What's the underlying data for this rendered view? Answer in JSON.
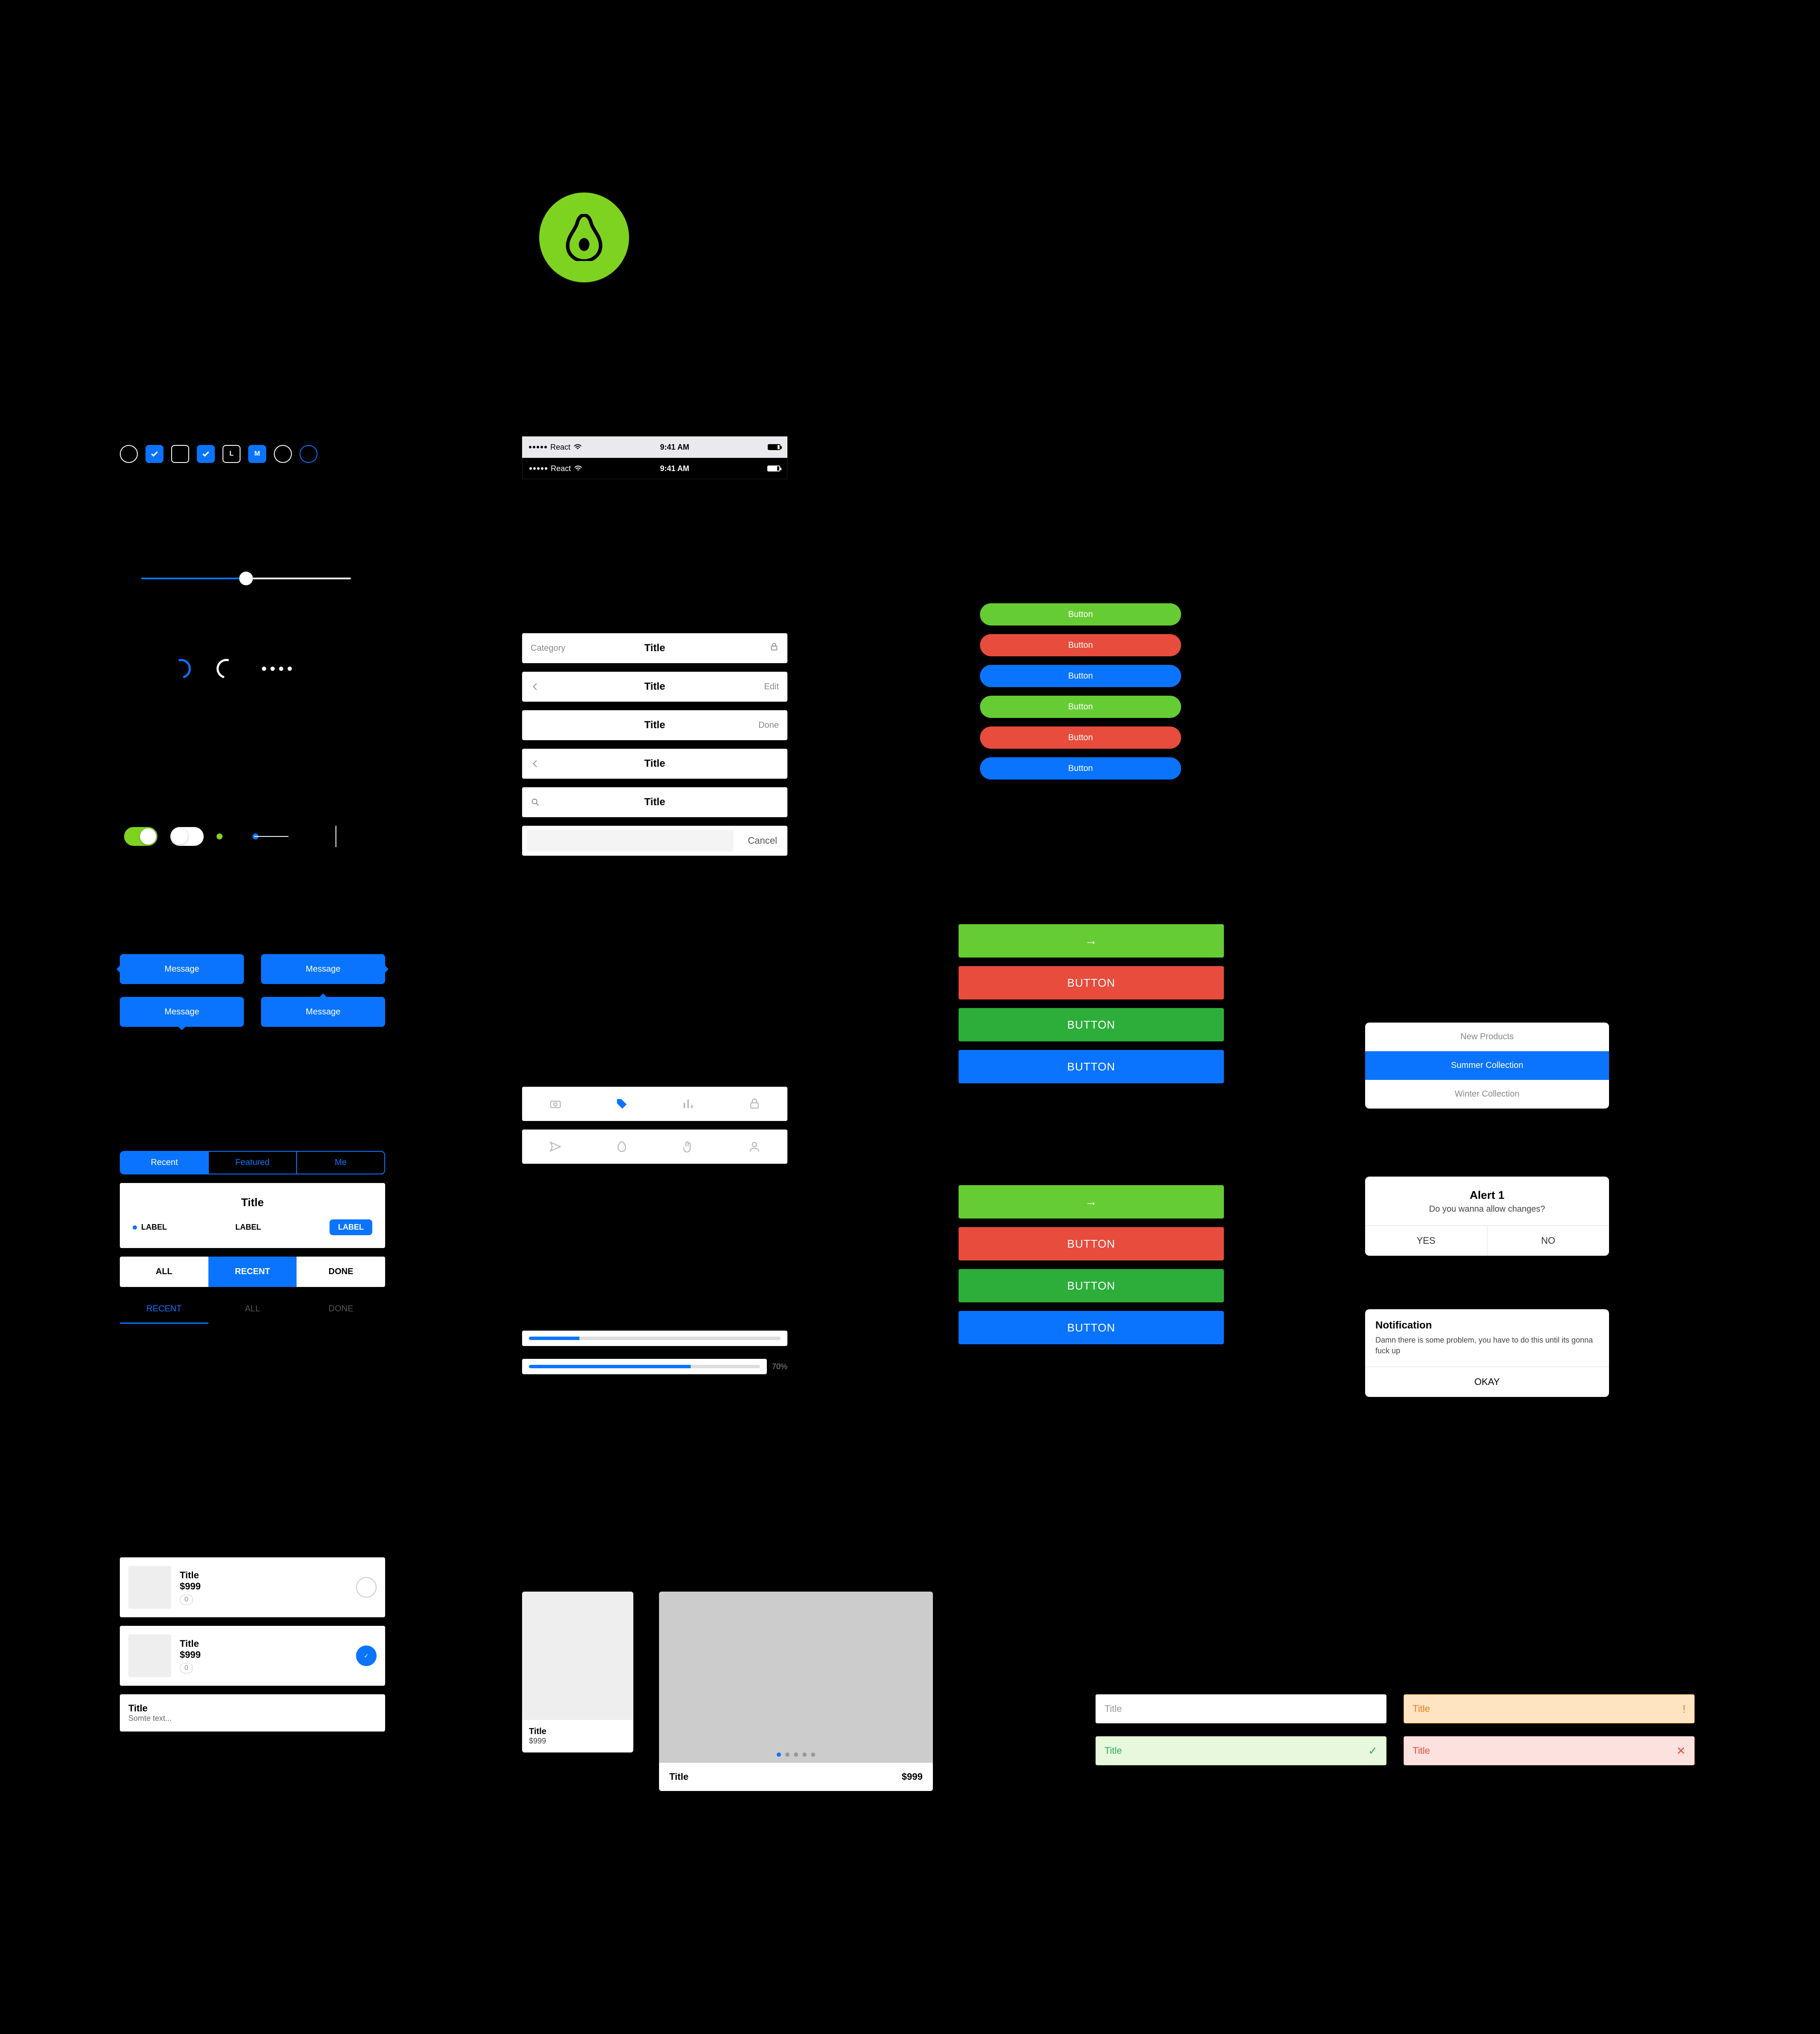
{
  "logo": {
    "name": "avocado-logo"
  },
  "chips": [
    {
      "type": "round",
      "style": "outline"
    },
    {
      "type": "square",
      "style": "blue",
      "icon": "check"
    },
    {
      "type": "square",
      "style": "outline"
    },
    {
      "type": "square",
      "style": "blue",
      "icon": "check"
    },
    {
      "type": "square",
      "style": "outline",
      "letter": "L"
    },
    {
      "type": "square",
      "style": "blue",
      "letter": "M"
    },
    {
      "type": "round",
      "style": "outline"
    },
    {
      "type": "round",
      "style": "outline-blue"
    }
  ],
  "slider": {
    "value_pct": 50
  },
  "spinners": {
    "dot_count": 4
  },
  "toggles": {
    "first": "on",
    "second": "off"
  },
  "messages": {
    "label": "Message",
    "positions": [
      "left",
      "right",
      "top",
      "bottom"
    ]
  },
  "tabs": {
    "segmented": [
      "Recent",
      "Featured",
      "Me"
    ],
    "segmented_active": 0,
    "card_title": "Title",
    "labels": [
      "LABEL",
      "LABEL",
      "LABEL"
    ],
    "seg3": [
      "ALL",
      "RECENT",
      "DONE"
    ],
    "seg3_active": 1,
    "undertabs": [
      "RECENT",
      "ALL",
      "DONE"
    ],
    "undertabs_active": 0
  },
  "statusbars": {
    "carrier": "React",
    "time": "9:41 AM"
  },
  "navbars": [
    {
      "left": "Category",
      "title": "Title",
      "right_icon": "lock"
    },
    {
      "left_icon": "back",
      "title": "Title",
      "right": "Edit"
    },
    {
      "left": "",
      "title": "Title",
      "right": "Done"
    },
    {
      "left_icon": "back",
      "title": "Title",
      "right": ""
    },
    {
      "left_icon": "search",
      "title": "Title",
      "right": ""
    }
  ],
  "cancel": {
    "placeholder": "",
    "button": "Cancel"
  },
  "tabbars": [
    {
      "icons": [
        "camera",
        "tag",
        "equalizer",
        "lock"
      ],
      "active": 1
    },
    {
      "icons": [
        "send",
        "egg",
        "hand",
        "user"
      ],
      "active": -1
    }
  ],
  "progress": {
    "p1": 20,
    "p2": 70,
    "label": "70%"
  },
  "buttons": {
    "pill_label": "Button",
    "big_label": "BUTTON",
    "arrow": "→",
    "groups": {
      "pills": [
        "green",
        "red",
        "blue",
        "green",
        "red",
        "blue"
      ],
      "block1": [
        "green-arrow",
        "red",
        "green2",
        "blue"
      ],
      "block2": [
        "green-arrow",
        "red",
        "green2",
        "blue"
      ]
    }
  },
  "popover": {
    "items": [
      "New Products",
      "Summer Collection",
      "Winter Collection"
    ],
    "selected": 1
  },
  "alert": {
    "title": "Alert 1",
    "message": "Do you wanna allow changes?",
    "buttons": [
      "YES",
      "NO"
    ]
  },
  "notification": {
    "title": "Notification",
    "message": "Damn there is some problem, you have to do this until its gonna fuck up",
    "button": "OKAY"
  },
  "list_items": [
    {
      "title": "Title",
      "price": "$999",
      "badge": "0",
      "checked": false
    },
    {
      "title": "Title",
      "price": "$999",
      "badge": "0",
      "checked": true
    }
  ],
  "list_sub": {
    "title": "Title",
    "subtitle": "Somte text..."
  },
  "product_card": {
    "title": "Title",
    "price": "$999"
  },
  "carousel": {
    "title": "Title",
    "price": "$999",
    "pages": 5,
    "active": 0
  },
  "inputs": {
    "placeholder": "Title",
    "states": [
      "normal",
      "warn",
      "ok",
      "err"
    ],
    "icons": {
      "warn": "!",
      "ok": "✓",
      "err": "✕"
    }
  },
  "colors": {
    "blue": "#0A74FF",
    "green": "#7ED321",
    "green2": "#2DAE3B",
    "btn_green": "#66CC33",
    "red": "#E74C3C",
    "orange": "#E67E22"
  }
}
